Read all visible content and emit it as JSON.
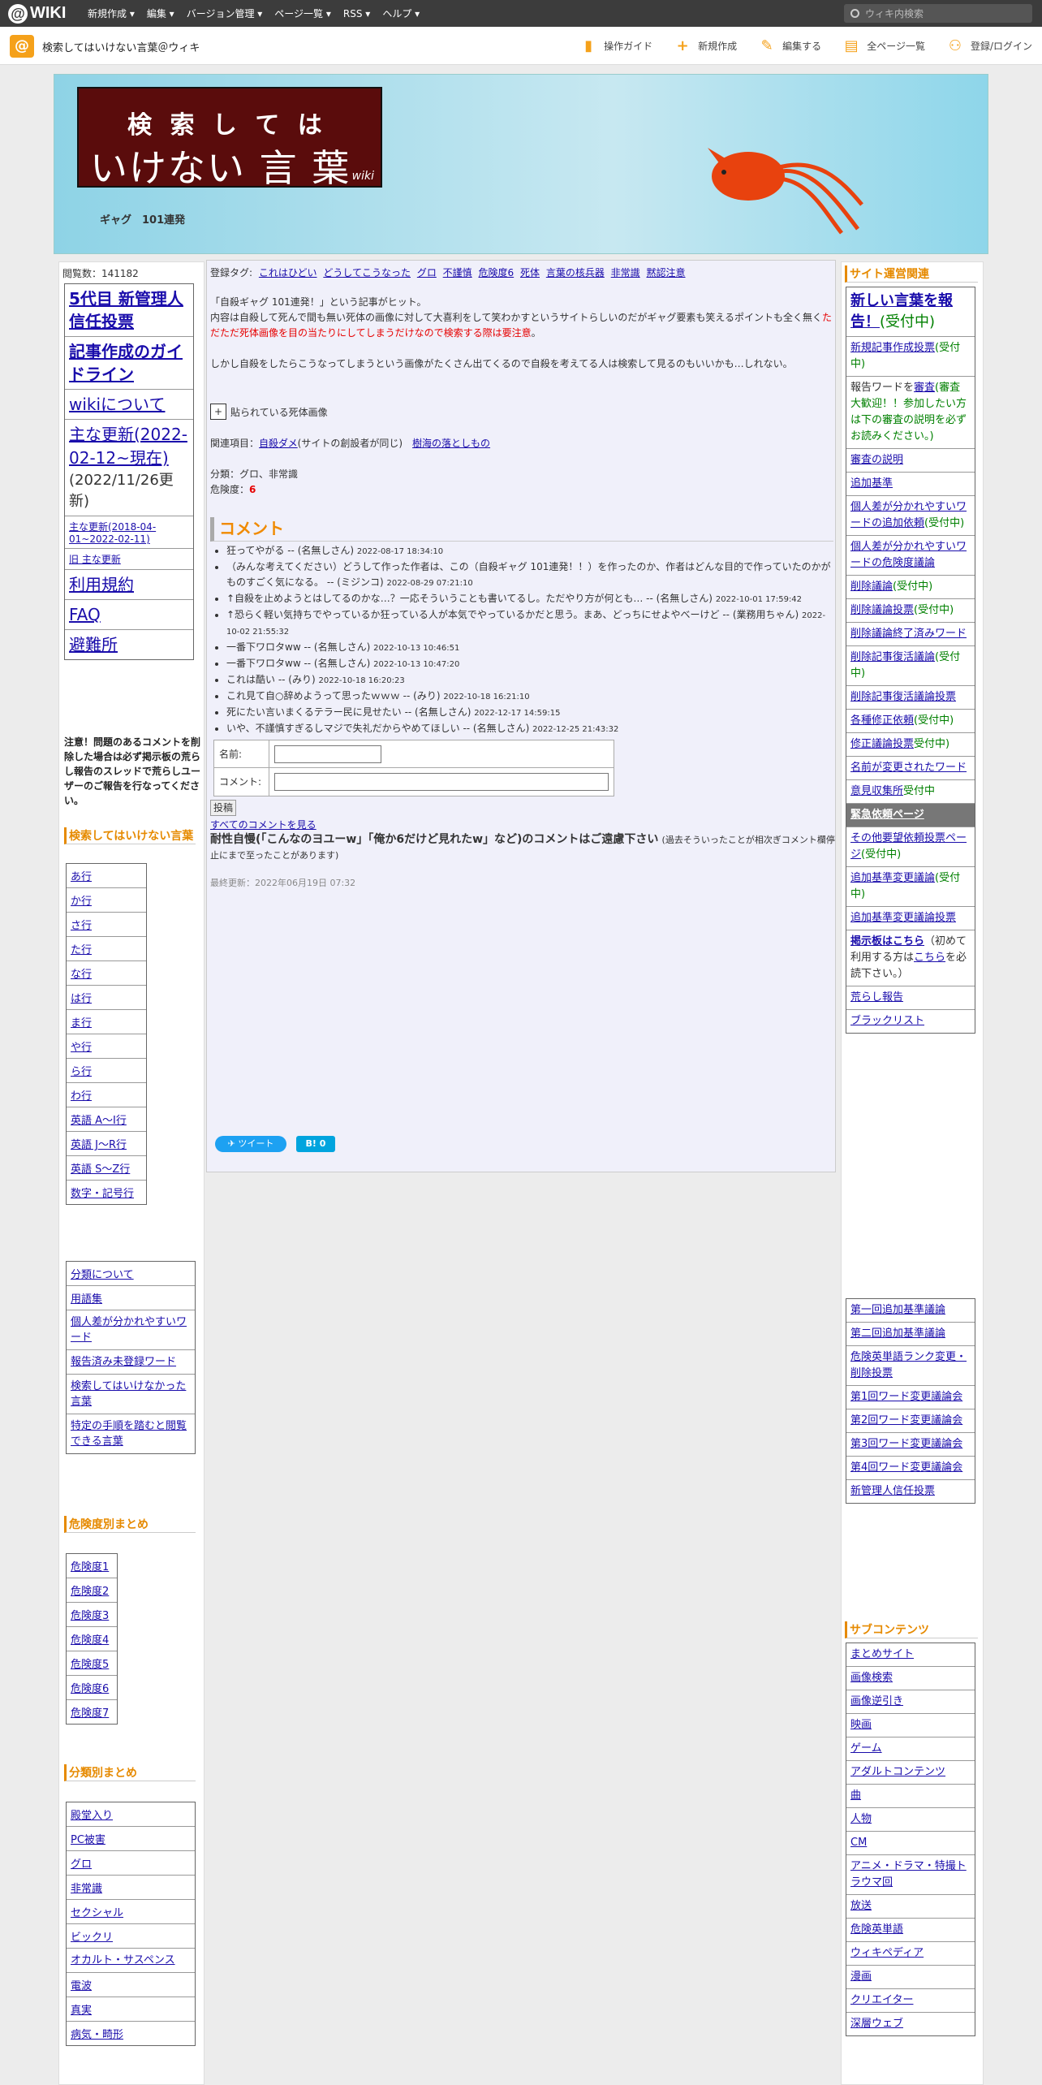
{
  "topbar": {
    "logo": "WIKI",
    "menu": [
      "新規作成 ▾",
      "編集 ▾",
      "バージョン管理 ▾",
      "ページ一覧 ▾",
      "RSS ▾",
      "ヘルプ ▾"
    ],
    "search_placeholder": "ウィキ内検索"
  },
  "sitebar": {
    "site_name": "検索してはいけない言葉＠ウィキ",
    "actions": [
      {
        "icon": "guide-icon",
        "label": "操作ガイド"
      },
      {
        "icon": "plus-icon",
        "label": "新規作成"
      },
      {
        "icon": "pencil-icon",
        "label": "編集する"
      },
      {
        "icon": "page-list-icon",
        "label": "全ページ一覧"
      },
      {
        "icon": "user-add-icon",
        "label": "登録/ログイン"
      }
    ]
  },
  "banner": {
    "logo_line1": "検 索 し て は",
    "logo_line2": "いけない 言 葉",
    "logo_wiki": "wiki",
    "tagline": "ギャグ　101連発"
  },
  "left": {
    "view_count": "閲覧数：141182",
    "top_links": [
      {
        "text": "5代目 新管理人信任投票",
        "size": "big",
        "bold": true
      },
      {
        "text": "記事作成のガイドライン",
        "size": "big",
        "bold": true
      },
      {
        "text": "wikiについて",
        "size": "big",
        "bold": false
      },
      {
        "text": "主な更新(2022-02-12~現在)",
        "suffix": "(2022/11/26更新)",
        "size": "big",
        "bold": false
      },
      {
        "text": "主な更新(2018-04-01~2022-02-11)",
        "size": "sm",
        "bold": false
      },
      {
        "text": "旧 主な更新",
        "size": "sm",
        "bold": false
      },
      {
        "text": "利用規約",
        "size": "big",
        "bold": false
      },
      {
        "text": "FAQ",
        "size": "big",
        "bold": false
      },
      {
        "text": "避難所",
        "size": "big",
        "bold": false
      }
    ],
    "note": "注意！問題のあるコメントを削除した場合は必ず掲示板の荒らし報告のスレッドで荒らしユーザーのご報告を行なってください。",
    "heading1": "検索してはいけない言葉",
    "kana_links": [
      "あ行",
      "か行",
      "さ行",
      "た行",
      "な行",
      "は行",
      "ま行",
      "や行",
      "ら行",
      "わ行",
      "英語 A〜I行",
      "英語 J〜R行",
      "英語 S〜Z行",
      "数字・記号行"
    ],
    "misc_links": [
      "分類について",
      "用語集",
      "個人差が分かれやすいワード",
      "報告済み未登録ワード",
      "検索してはいけなかった言葉",
      "特定の手順を踏むと閲覧できる言葉"
    ],
    "heading2": "危険度別まとめ",
    "danger_links": [
      "危険度1",
      "危険度2",
      "危険度3",
      "危険度4",
      "危険度5",
      "危険度6",
      "危険度7"
    ],
    "heading3": "分類別まとめ",
    "category_links": [
      "殿堂入り",
      "PC被害",
      "グロ",
      "非常識",
      "セクシャル",
      "ビックリ",
      "オカルト・サスペンス",
      "電波",
      "真実",
      "病気・畸形"
    ]
  },
  "main": {
    "tags_label": "登録タグ:",
    "tags": [
      "これはひどい",
      "どうしてこうなった",
      "グロ",
      "不謹慎",
      "危険度6",
      "死体",
      "言葉の核兵器",
      "非常識",
      "黙認注意"
    ],
    "intro1": "「自殺ギャグ 101連発！」という記事がヒット。",
    "intro2a": "内容は自殺して死んで間も無い死体の画像に対して大喜利をして笑わかすというサイトらしいのだがギャグ要素も笑えるポイントも全く無く",
    "intro2b": "ただただ死体画像を目の当たりにしてしまうだけなので検索する際は要注意",
    "intro2c": "。",
    "intro3": "しかし自殺をしたらこうなってしまうという画像がたくさん出てくるので自殺を考えてる人は検索して見るのもいいかも…しれない。",
    "toggle_box": "+",
    "toggle_label": "貼られている死体画像",
    "related_label": "関連項目：",
    "related1": "自殺ダメ",
    "related1_note": "(サイトの創設者が同じ)",
    "related2": "樹海の落としもの",
    "category_line": "分類：グロ、非常識",
    "danger_label": "危険度：",
    "danger_value": "6",
    "comment_heading": "コメント",
    "comments": [
      {
        "text": "狂ってやがる -- (名無しさん)",
        "ts": "2022-08-17 18:34:10"
      },
      {
        "text": "（みんな考えてください）どうして作った作者は、この（自殺ギャグ 101連発！！）を作ったのか、作者はどんな目的で作っていたのかがものすごく気になる。 -- (ミジンコ)",
        "ts": "2022-08-29 07:21:10"
      },
      {
        "text": "↑自殺を止めようとはしてるのかな…？一応そういうことも書いてるし。ただやり方が何とも… -- (名無しさん)",
        "ts": "2022-10-01 17:59:42"
      },
      {
        "text": "↑恐らく軽い気持ちでやっているか狂っている人が本気でやっているかだと思う。まあ、どっちにせよやべーけど -- (業務用ちゃん)",
        "ts": "2022-10-02 21:55:32"
      },
      {
        "text": "一番下ワロタww -- (名無しさん)",
        "ts": "2022-10-13 10:46:51"
      },
      {
        "text": "一番下ワロタww -- (名無しさん)",
        "ts": "2022-10-13 10:47:20"
      },
      {
        "text": "これは酷い -- (みり)",
        "ts": "2022-10-18 16:20:23"
      },
      {
        "text": "これ見て自○辞めようって思ったｗｗｗ -- (みり)",
        "ts": "2022-10-18 16:21:10"
      },
      {
        "text": "死にたい言いまくるテラー民に見せたい -- (名無しさん)",
        "ts": "2022-12-17 14:59:15"
      },
      {
        "text": "いや、不謹慎すぎるしマジで失礼だからやめてほしい -- (名無しさん)",
        "ts": "2022-12-25 21:43:32"
      }
    ],
    "form_name_label": "名前:",
    "form_comment_label": "コメント:",
    "submit_label": "投稿",
    "all_comments_link": "すべてのコメントを見る",
    "warn_bold": "耐性自慢(「こんなのヨユーw」「俺か6だけど見れたw」など)のコメントはご遠慮下さい",
    "warn_small": "(過去そういったことが相次ぎコメント欄停止にまで至ったことがあります)",
    "last_updated": "最終更新：2022年06月19日 07:32",
    "tweet_label": "ツイート",
    "hatena_label": "B! 0"
  },
  "right": {
    "heading1": "サイト運営関連",
    "ops_links": [
      {
        "text": "新しい言葉を報告！",
        "suffix": "(受付中)",
        "style": "big"
      },
      {
        "text": "新規記事作成投票",
        "suffix": "(受付中)",
        "style": "normal"
      },
      {
        "pre": "報告ワードを",
        "text": "審査",
        "suffix": "(審査大歓迎！！参加したい方は下の審査の説明を必ずお読みください。)",
        "style": "review"
      },
      {
        "text": "審査の説明",
        "style": "normal"
      },
      {
        "text": "追加基準",
        "style": "normal"
      },
      {
        "text": "個人差が分かれやすいワードの追加依頼",
        "suffix": "(受付中)",
        "style": "normal"
      },
      {
        "text": "個人差が分かれやすいワードの危険度議論",
        "style": "normal"
      },
      {
        "text": "削除議論",
        "suffix": "(受付中)",
        "style": "normal"
      },
      {
        "text": "削除議論投票",
        "suffix": "(受付中)",
        "style": "normal"
      },
      {
        "text": "削除議論終了済みワード",
        "style": "normal"
      },
      {
        "text": "削除記事復活議論",
        "suffix": "(受付中)",
        "style": "normal"
      },
      {
        "text": "削除記事復活議論投票",
        "style": "normal"
      },
      {
        "text": "各種修正依頼",
        "suffix": "(受付中)",
        "style": "normal"
      },
      {
        "text": "修正議論投票",
        "suffix": "受付中)",
        "style": "normal"
      },
      {
        "text": "名前が変更されたワード",
        "style": "normal"
      },
      {
        "text": "意見収集所",
        "suffix": "受付中",
        "style": "normal"
      },
      {
        "text": "緊急依頼ページ",
        "style": "dark"
      },
      {
        "text": "その他要望依頼投票ページ",
        "suffix": "(受付中)",
        "style": "normal"
      },
      {
        "text": "追加基準変更議論",
        "suffix": "(受付中)",
        "style": "normal"
      },
      {
        "text": "追加基準変更議論投票",
        "style": "normal"
      },
      {
        "text": "掲示板はこちら",
        "mid": "（初めて利用する方は",
        "text2": "こちら",
        "suffix": "を必読下さい。）",
        "style": "board"
      },
      {
        "text": "荒らし報告",
        "style": "normal"
      },
      {
        "text": "ブラックリスト",
        "style": "normal"
      }
    ],
    "meeting_links": [
      "第一回追加基準議論",
      "第二回追加基準議論",
      "危険英単語ランク変更・削除投票",
      "第1回ワード変更議論会",
      "第2回ワード変更議論会",
      "第3回ワード変更議論会",
      "第4回ワード変更議論会",
      "新管理人信任投票"
    ],
    "heading2": "サブコンテンツ",
    "sub_links": [
      "まとめサイト",
      "画像検索",
      "画像逆引き",
      "映画",
      "ゲーム",
      "アダルトコンテンツ",
      "曲",
      "人物",
      "CM",
      "アニメ・ドラマ・特撮トラウマ回",
      "放送",
      "危険英単語",
      "ウィキペディア",
      "漫画",
      "クリエイター",
      "深層ウェブ"
    ]
  }
}
